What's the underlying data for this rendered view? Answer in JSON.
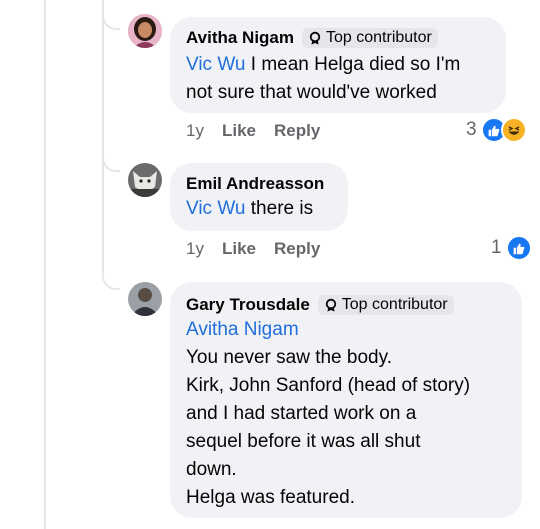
{
  "comments": [
    {
      "author": "Avitha Nigam",
      "badge": "Top contributor",
      "mention": "Vic Wu",
      "text_line1": " I mean Helga died so I'm",
      "text_line2": "not sure that would've worked",
      "time": "1y",
      "like": "Like",
      "reply": "Reply",
      "reaction_count": "3",
      "reactions": [
        "like-icon",
        "haha-icon"
      ]
    },
    {
      "author": "Emil Andreasson",
      "mention": "Vic Wu",
      "text_line1": " there is",
      "time": "1y",
      "like": "Like",
      "reply": "Reply",
      "reaction_count": "1",
      "reactions": [
        "like-icon"
      ]
    },
    {
      "author": "Gary Trousdale",
      "badge": "Top contributor",
      "mention": "Avitha Nigam",
      "lines": [
        "You never saw the body.",
        "Kirk, John Sanford (head of story)",
        "and I had started work on a",
        "sequel before it was all shut",
        "down.",
        "Helga was featured."
      ]
    }
  ],
  "colors": {
    "mention": "#216fdb",
    "bubble": "#f0f2f5",
    "like": "#1877f2",
    "meta": "#65676b"
  }
}
